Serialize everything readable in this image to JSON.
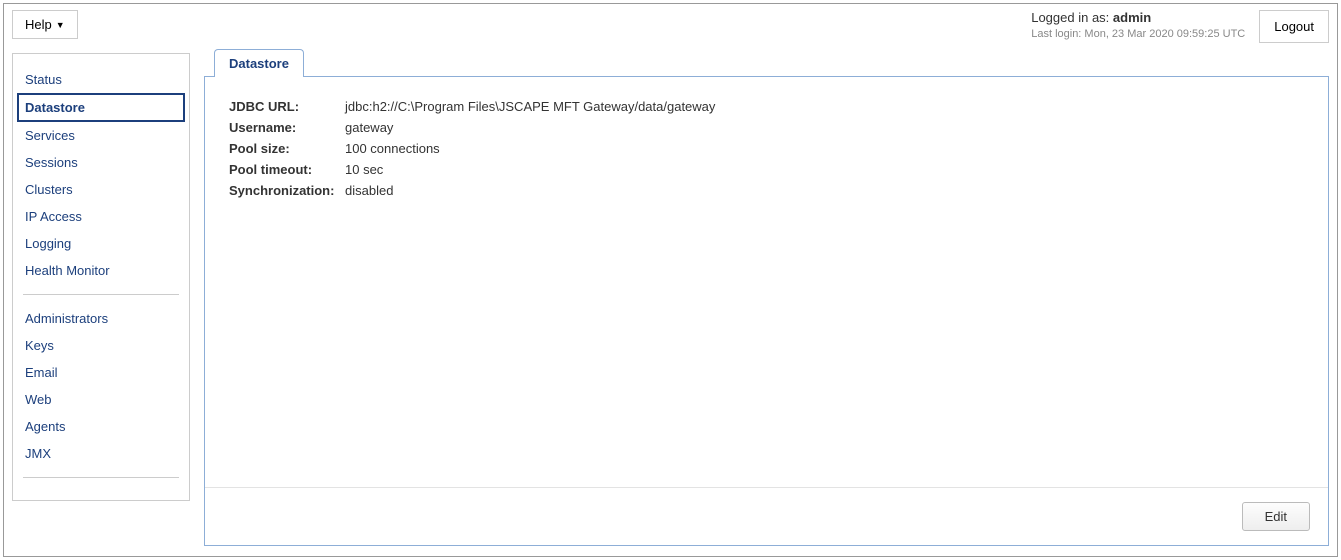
{
  "topbar": {
    "help_label": "Help",
    "logged_in_prefix": "Logged in as: ",
    "logged_in_user": "admin",
    "last_login": "Last login: Mon, 23 Mar 2020 09:59:25 UTC",
    "logout_label": "Logout"
  },
  "sidebar": {
    "group1": [
      {
        "label": "Status",
        "selected": false
      },
      {
        "label": "Datastore",
        "selected": true
      },
      {
        "label": "Services",
        "selected": false
      },
      {
        "label": "Sessions",
        "selected": false
      },
      {
        "label": "Clusters",
        "selected": false
      },
      {
        "label": "IP Access",
        "selected": false
      },
      {
        "label": "Logging",
        "selected": false
      },
      {
        "label": "Health Monitor",
        "selected": false
      }
    ],
    "group2": [
      {
        "label": "Administrators"
      },
      {
        "label": "Keys"
      },
      {
        "label": "Email"
      },
      {
        "label": "Web"
      },
      {
        "label": "Agents"
      },
      {
        "label": "JMX"
      }
    ]
  },
  "tab": {
    "label": "Datastore"
  },
  "fields": [
    {
      "label": "JDBC URL:",
      "value": "jdbc:h2://C:\\Program Files\\JSCAPE MFT Gateway/data/gateway"
    },
    {
      "label": "Username:",
      "value": "gateway"
    },
    {
      "label": "Pool size:",
      "value": "100 connections"
    },
    {
      "label": "Pool timeout:",
      "value": "10 sec"
    },
    {
      "label": "Synchronization:",
      "value": "disabled"
    }
  ],
  "footer": {
    "edit_label": "Edit"
  }
}
